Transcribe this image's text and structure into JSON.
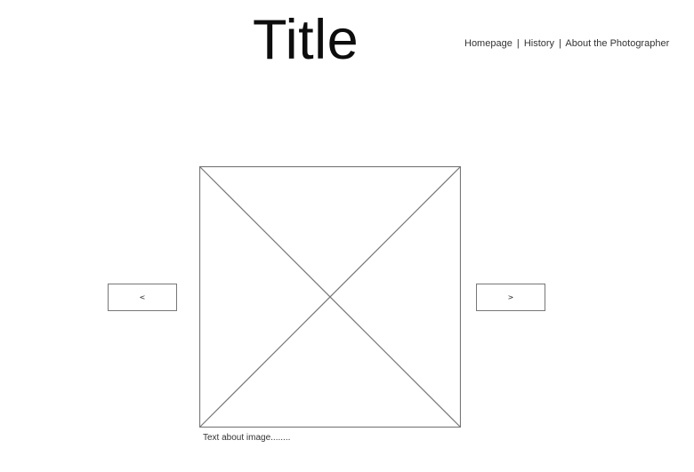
{
  "header": {
    "title": "Title",
    "nav": [
      {
        "label": "Homepage"
      },
      {
        "label": "History"
      },
      {
        "label": "About the Photographer"
      }
    ],
    "separator": "|"
  },
  "gallery": {
    "prev_label": "<",
    "next_label": ">",
    "caption": "Text about image........",
    "placeholder_icon": "image-placeholder-icon",
    "stroke_color": "#777777"
  }
}
